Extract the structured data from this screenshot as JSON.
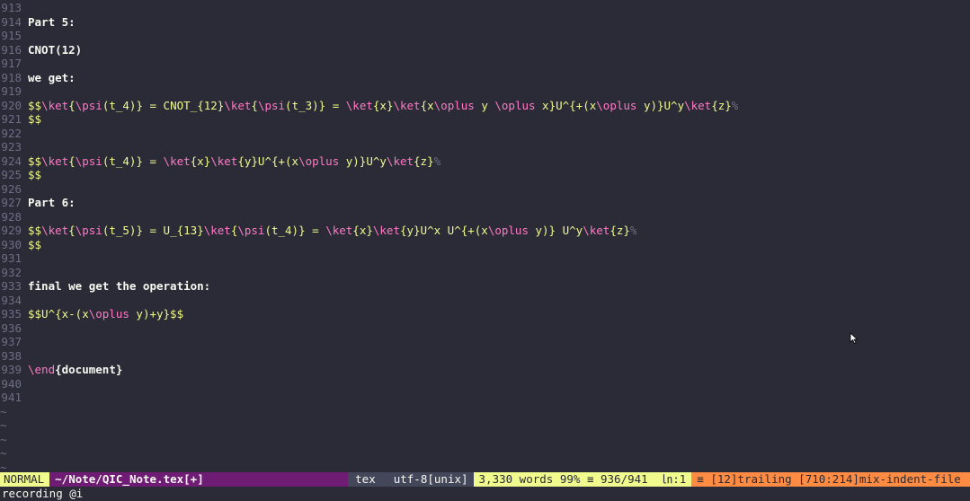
{
  "lines": [
    {
      "num": "913",
      "segs": []
    },
    {
      "num": "914",
      "segs": [
        {
          "t": "Part 5:",
          "c": "c-bold-white"
        }
      ]
    },
    {
      "num": "915",
      "segs": []
    },
    {
      "num": "916",
      "segs": [
        {
          "t": "CNOT(12)",
          "c": "c-bold-white"
        }
      ]
    },
    {
      "num": "917",
      "segs": []
    },
    {
      "num": "918",
      "segs": [
        {
          "t": "we get:",
          "c": "c-bold-white"
        }
      ]
    },
    {
      "num": "919",
      "segs": []
    },
    {
      "num": "920",
      "segs": [
        {
          "t": "$$",
          "c": "c-yellow"
        },
        {
          "t": "\\ket",
          "c": "c-pink"
        },
        {
          "t": "{",
          "c": "c-yellow"
        },
        {
          "t": "\\psi",
          "c": "c-pink"
        },
        {
          "t": "(t_4)",
          "c": "c-yellow"
        },
        {
          "t": "}",
          "c": "c-yellow"
        },
        {
          "t": " = CNOT_{12}",
          "c": "c-yellow"
        },
        {
          "t": "\\ket",
          "c": "c-pink"
        },
        {
          "t": "{",
          "c": "c-yellow"
        },
        {
          "t": "\\psi",
          "c": "c-pink"
        },
        {
          "t": "(t_3)}",
          "c": "c-yellow"
        },
        {
          "t": " = ",
          "c": "c-yellow"
        },
        {
          "t": "\\ket",
          "c": "c-pink"
        },
        {
          "t": "{x}",
          "c": "c-yellow"
        },
        {
          "t": "\\ket",
          "c": "c-pink"
        },
        {
          "t": "{x",
          "c": "c-yellow"
        },
        {
          "t": "\\oplus",
          "c": "c-pink"
        },
        {
          "t": " y ",
          "c": "c-yellow"
        },
        {
          "t": "\\oplus",
          "c": "c-pink"
        },
        {
          "t": " x}U^{+(x",
          "c": "c-yellow"
        },
        {
          "t": "\\oplus",
          "c": "c-pink"
        },
        {
          "t": " y)}U^y",
          "c": "c-yellow"
        },
        {
          "t": "\\ket",
          "c": "c-pink"
        },
        {
          "t": "{z}",
          "c": "c-yellow"
        },
        {
          "t": "%",
          "c": "c-dim"
        }
      ]
    },
    {
      "num": "921",
      "segs": [
        {
          "t": "$$",
          "c": "c-yellow"
        }
      ]
    },
    {
      "num": "922",
      "segs": []
    },
    {
      "num": "923",
      "segs": []
    },
    {
      "num": "924",
      "segs": [
        {
          "t": "$$",
          "c": "c-yellow"
        },
        {
          "t": "\\ket",
          "c": "c-pink"
        },
        {
          "t": "{",
          "c": "c-yellow"
        },
        {
          "t": "\\psi",
          "c": "c-pink"
        },
        {
          "t": "(t_4)}",
          "c": "c-yellow"
        },
        {
          "t": " = ",
          "c": "c-yellow"
        },
        {
          "t": "\\ket",
          "c": "c-pink"
        },
        {
          "t": "{x}",
          "c": "c-yellow"
        },
        {
          "t": "\\ket",
          "c": "c-pink"
        },
        {
          "t": "{y}U^{+(x",
          "c": "c-yellow"
        },
        {
          "t": "\\oplus",
          "c": "c-pink"
        },
        {
          "t": " y)}U^y",
          "c": "c-yellow"
        },
        {
          "t": "\\ket",
          "c": "c-pink"
        },
        {
          "t": "{z}",
          "c": "c-yellow"
        },
        {
          "t": "%",
          "c": "c-dim"
        }
      ]
    },
    {
      "num": "925",
      "segs": [
        {
          "t": "$$",
          "c": "c-yellow"
        }
      ]
    },
    {
      "num": "926",
      "segs": []
    },
    {
      "num": "927",
      "segs": [
        {
          "t": "Part 6:",
          "c": "c-bold-white"
        }
      ]
    },
    {
      "num": "928",
      "segs": []
    },
    {
      "num": "929",
      "segs": [
        {
          "t": "$$",
          "c": "c-yellow"
        },
        {
          "t": "\\ket",
          "c": "c-pink"
        },
        {
          "t": "{",
          "c": "c-yellow"
        },
        {
          "t": "\\psi",
          "c": "c-pink"
        },
        {
          "t": "(t_5)}",
          "c": "c-yellow"
        },
        {
          "t": " = U_{13}",
          "c": "c-yellow"
        },
        {
          "t": "\\ket",
          "c": "c-pink"
        },
        {
          "t": "{",
          "c": "c-yellow"
        },
        {
          "t": "\\psi",
          "c": "c-pink"
        },
        {
          "t": "(t_4)}",
          "c": "c-yellow"
        },
        {
          "t": " = ",
          "c": "c-yellow"
        },
        {
          "t": "\\ket",
          "c": "c-pink"
        },
        {
          "t": "{x}",
          "c": "c-yellow"
        },
        {
          "t": "\\ket",
          "c": "c-pink"
        },
        {
          "t": "{y}U^x U^{+(x",
          "c": "c-yellow"
        },
        {
          "t": "\\oplus",
          "c": "c-pink"
        },
        {
          "t": " y)} U^y",
          "c": "c-yellow"
        },
        {
          "t": "\\ket",
          "c": "c-pink"
        },
        {
          "t": "{z}",
          "c": "c-yellow"
        },
        {
          "t": "%",
          "c": "c-dim"
        }
      ]
    },
    {
      "num": "930",
      "segs": [
        {
          "t": "$$",
          "c": "c-yellow"
        }
      ]
    },
    {
      "num": "931",
      "segs": []
    },
    {
      "num": "932",
      "segs": []
    },
    {
      "num": "933",
      "segs": [
        {
          "t": "final we get the operation:",
          "c": "c-bold-white"
        }
      ]
    },
    {
      "num": "934",
      "segs": []
    },
    {
      "num": "935",
      "segs": [
        {
          "t": "$$U^{x-(x",
          "c": "c-yellow"
        },
        {
          "t": "\\oplus",
          "c": "c-pink"
        },
        {
          "t": " y)+y}$$",
          "c": "c-yellow"
        }
      ]
    },
    {
      "num": "936",
      "segs": []
    },
    {
      "num": "937",
      "segs": []
    },
    {
      "num": "938",
      "segs": []
    },
    {
      "num": "939",
      "segs": [
        {
          "t": "\\end",
          "c": "c-pink"
        },
        {
          "t": "{document}",
          "c": "c-bold-white"
        }
      ]
    },
    {
      "num": "940",
      "segs": []
    },
    {
      "num": "941",
      "segs": []
    }
  ],
  "tildes": [
    "~",
    "~",
    "~",
    "~",
    "~"
  ],
  "statusline": {
    "mode": "NORMAL",
    "file": "~/Note/QIC_Note.tex[+]",
    "filetype": "tex",
    "encoding": "utf-8[unix]",
    "words": "3,330 words 99% ≡ 936/941  ㏑:1",
    "warnings": "≡ [12]trailing [710:214]mix-indent-file"
  },
  "cmdline": "recording @i",
  "colors": {
    "background": "#2a2b36",
    "pink": "#ff79c6",
    "yellow": "#f1fa8c",
    "statusline_file": "#6f1d74",
    "warning": "#ff8c42"
  }
}
